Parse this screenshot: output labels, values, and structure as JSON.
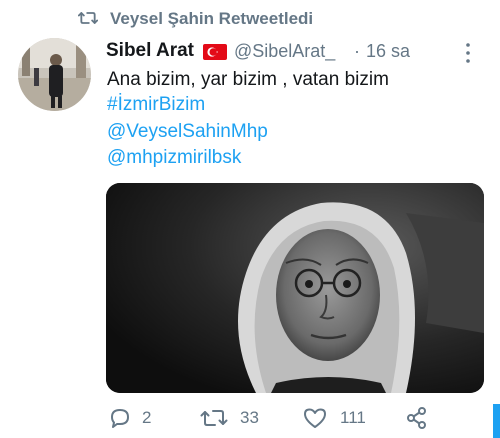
{
  "retweet_banner": {
    "icon": "retweet-icon",
    "text": "Veysel Şahin Retweetledi"
  },
  "tweet": {
    "author_name": "Sibel Arat",
    "flag": "turkey-flag",
    "handle": "@SibelArat_",
    "separator": "·",
    "time": "16 sa",
    "text": "Ana bizim, yar bizim ,  vatan bizim",
    "hashtag": "#İzmirBizim",
    "mention_1": "@VeyselSahinMhp",
    "mention_2": "@mhpizmirilbsk",
    "media": {
      "kind": "photo",
      "description_icon": "photo"
    }
  },
  "actions": {
    "reply_count": "2",
    "retweet_count": "33",
    "like_count": "111"
  },
  "colors": {
    "link": "#1da1f2",
    "muted": "#657786",
    "text": "#14171a"
  }
}
